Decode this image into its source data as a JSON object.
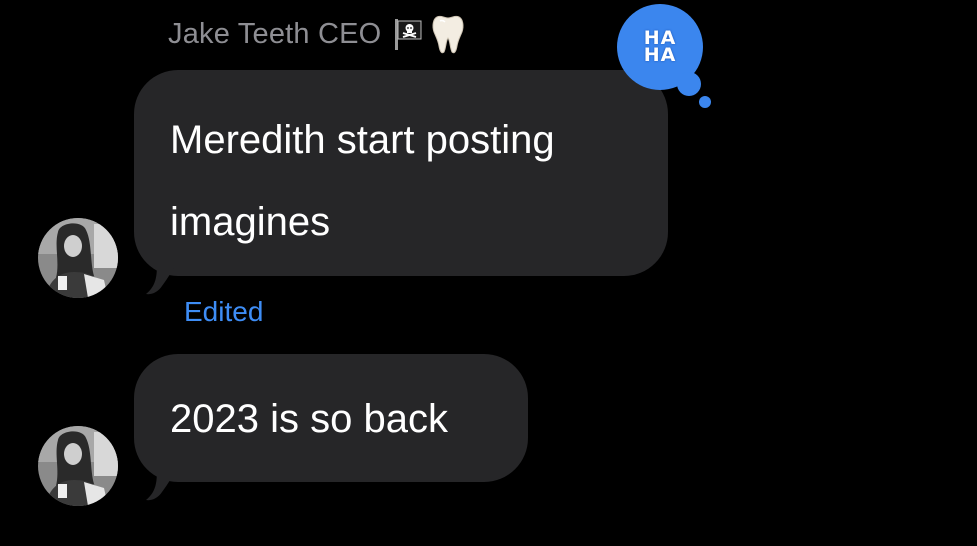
{
  "thread": {
    "sender_name": "Jake Teeth CEO",
    "sender_badges": [
      "pirate-flag-icon",
      "tooth-icon"
    ],
    "messages": [
      {
        "text_lines": [
          "Meredith start posting",
          "imagines"
        ],
        "reaction": [
          "HA",
          "HA"
        ],
        "status": "Edited"
      },
      {
        "text_lines": [
          "2023 is so back"
        ]
      }
    ]
  },
  "colors": {
    "background": "#000000",
    "bubble": "#262628",
    "accent": "#3b86ee",
    "edited": "#3e8df5",
    "sender_name": "#8e8e93"
  }
}
